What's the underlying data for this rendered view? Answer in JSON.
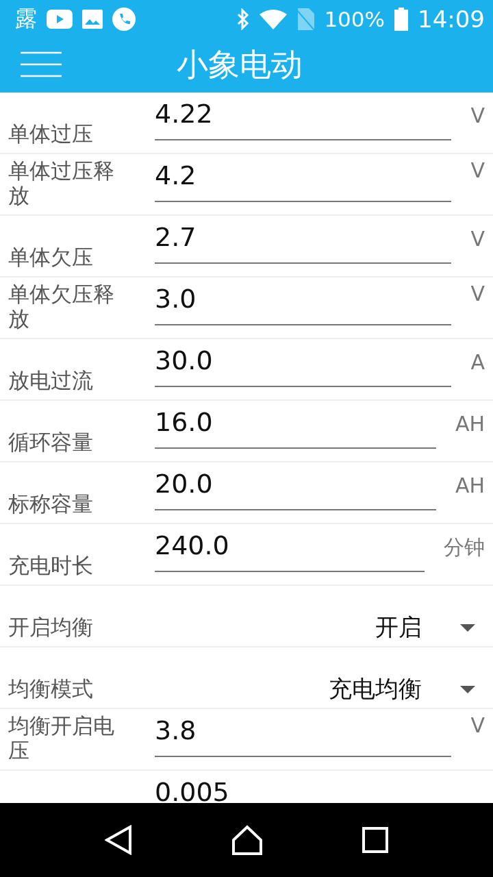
{
  "status_bar": {
    "notification_text": "露",
    "battery": "100%",
    "time": "14:09"
  },
  "app_bar": {
    "title": "小象电动"
  },
  "settings": [
    {
      "kind": "field",
      "label": "单体过压",
      "value": "4.22",
      "unit": "V"
    },
    {
      "kind": "field",
      "label": "单体过压释放",
      "value": "4.2",
      "unit": "V"
    },
    {
      "kind": "field",
      "label": "单体欠压",
      "value": "2.7",
      "unit": "V"
    },
    {
      "kind": "field",
      "label": "单体欠压释放",
      "value": "3.0",
      "unit": "V"
    },
    {
      "kind": "field",
      "label": "放电过流",
      "value": "30.0",
      "unit": "A"
    },
    {
      "kind": "field",
      "label": "循环容量",
      "value": "16.0",
      "unit": "AH"
    },
    {
      "kind": "field",
      "label": "标称容量",
      "value": "20.0",
      "unit": "AH"
    },
    {
      "kind": "field",
      "label": "充电时长",
      "value": "240.0",
      "unit": "分钟"
    },
    {
      "kind": "dropdown",
      "label": "开启均衡",
      "value": "开启"
    },
    {
      "kind": "dropdown",
      "label": "均衡模式",
      "value": "充电均衡"
    },
    {
      "kind": "field",
      "label": "均衡开启电压",
      "value": "3.8",
      "unit": "V"
    },
    {
      "kind": "field",
      "value": "0.005"
    }
  ]
}
